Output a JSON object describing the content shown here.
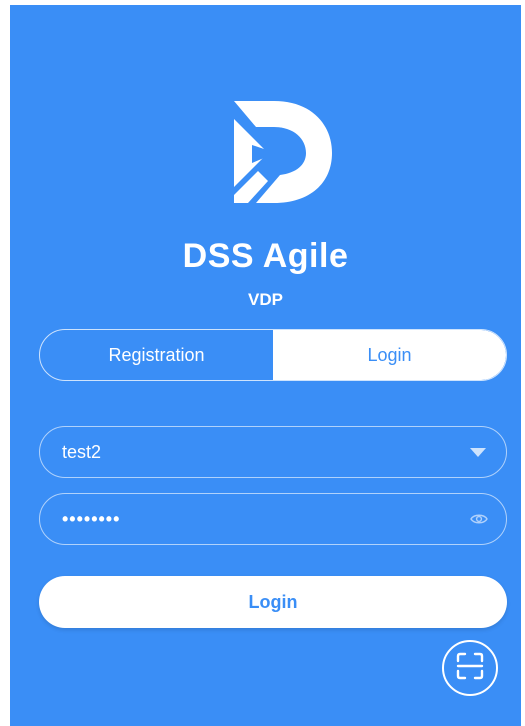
{
  "app": {
    "name": "DSS Agile",
    "subtitle": "VDP"
  },
  "tabs": [
    {
      "label": "Registration",
      "active": false
    },
    {
      "label": "Login",
      "active": true
    }
  ],
  "form": {
    "username": "test2",
    "password_mask": "••••••••"
  },
  "login_button": "Login",
  "colors": {
    "background": "#3a8ef6",
    "accent_text": "#3a8ef6",
    "foreground": "#ffffff"
  },
  "icons": {
    "logo": "dss-logo-icon",
    "dropdown": "chevron-down-icon",
    "password_toggle": "eye-icon",
    "scan": "qr-scan-icon"
  }
}
